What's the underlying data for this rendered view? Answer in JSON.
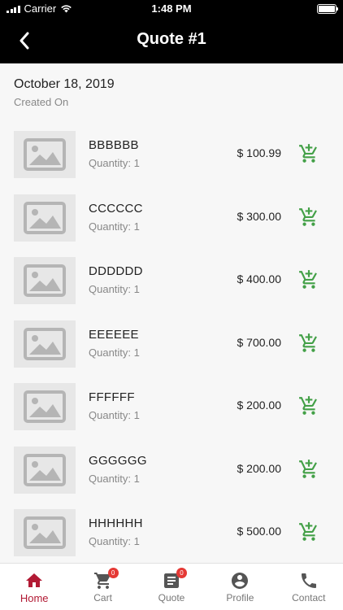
{
  "status_bar": {
    "carrier": "Carrier",
    "time": "1:48 PM"
  },
  "nav": {
    "title": "Quote #1"
  },
  "quote": {
    "date": "October 18, 2019",
    "date_caption": "Created On"
  },
  "items": [
    {
      "name": "BBBBBB",
      "quantity": "Quantity: 1",
      "price": "$ 100.99"
    },
    {
      "name": "CCCCCC",
      "quantity": "Quantity: 1",
      "price": "$ 300.00"
    },
    {
      "name": "DDDDDD",
      "quantity": "Quantity: 1",
      "price": "$ 400.00"
    },
    {
      "name": "EEEEEE",
      "quantity": "Quantity: 1",
      "price": "$ 700.00"
    },
    {
      "name": "FFFFFF",
      "quantity": "Quantity: 1",
      "price": "$ 200.00"
    },
    {
      "name": "GGGGGG",
      "quantity": "Quantity: 1",
      "price": "$ 200.00"
    },
    {
      "name": "HHHHHH",
      "quantity": "Quantity: 1",
      "price": "$ 500.00"
    }
  ],
  "tabs": [
    {
      "label": "Home",
      "icon": "home-icon",
      "active": true
    },
    {
      "label": "Cart",
      "icon": "cart-icon",
      "badge": "0"
    },
    {
      "label": "Quote",
      "icon": "quote-icon",
      "badge": "0"
    },
    {
      "label": "Profile",
      "icon": "profile-icon"
    },
    {
      "label": "Contact",
      "icon": "phone-icon"
    }
  ],
  "colors": {
    "accent": "#b21a34",
    "add_to_cart": "#43a047",
    "badge": "#e53935",
    "header": "#000000"
  }
}
